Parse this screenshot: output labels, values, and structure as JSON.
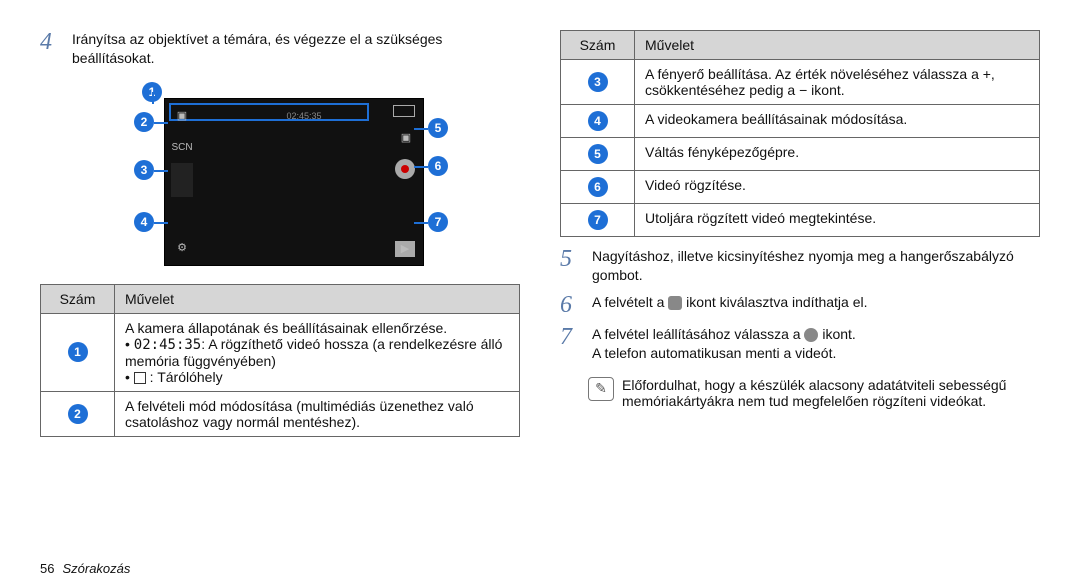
{
  "left": {
    "step4": "Irányítsa az objektívet a témára, és végezze el a szükséges beállításokat.",
    "timecode": "02:45:35",
    "table": {
      "head": {
        "num": "Szám",
        "op": "Művelet"
      },
      "rows": [
        {
          "n": "1",
          "lines": [
            "A kamera állapotának és beállításainak ellenőrzése.",
            "•  A rögzíthető videó hossza (a rendelkezésre álló memória függvényében)",
            "•  : Tárólóhely"
          ]
        },
        {
          "n": "2",
          "lines": [
            "A felvételi mód módosítása (multimédiás üzenethez való csatoláshoz vagy normál mentéshez)."
          ]
        }
      ]
    }
  },
  "right": {
    "table": {
      "head": {
        "num": "Szám",
        "op": "Művelet"
      },
      "rows": [
        {
          "n": "3",
          "text": "A fényerő beállítása. Az érték növeléséhez válassza a +, csökkentéséhez pedig a − ikont."
        },
        {
          "n": "4",
          "text": "A videokamera beállításainak módosítása."
        },
        {
          "n": "5",
          "text": "Váltás fényképezőgépre."
        },
        {
          "n": "6",
          "text": "Videó rögzítése."
        },
        {
          "n": "7",
          "text": "Utoljára rögzített videó megtekintése."
        }
      ]
    },
    "step5": "Nagyításhoz, illetve kicsinyítéshez nyomja meg a hangerőszabályzó gombot.",
    "step6_a": "A felvételt a ",
    "step6_b": " ikont kiválasztva indíthatja el.",
    "step7_a": "A felvétel leállításához válassza a ",
    "step7_b": " ikont.",
    "step7_c": "A telefon automatikusan menti a videót.",
    "note": "Előfordulhat, hogy a készülék alacsony adatátviteli sebességű memóriakártyákra nem tud megfelelően rögzíteni videókat."
  },
  "footer": {
    "page": "56",
    "section": "Szórakozás"
  }
}
